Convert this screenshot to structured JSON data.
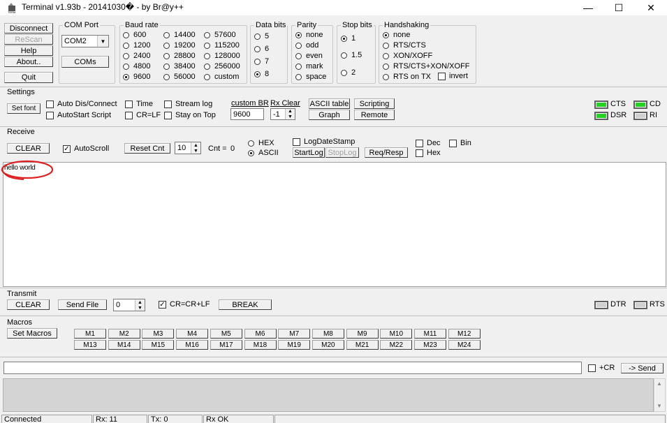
{
  "window": {
    "title": "Terminal v1.93b - 20141030� - by Br@y++",
    "min": "—",
    "max": "☐",
    "close": "✕"
  },
  "left_buttons": {
    "disconnect": "Disconnect",
    "rescan": "ReScan",
    "help": "Help",
    "about": "About..",
    "quit": "Quit"
  },
  "com_port": {
    "title": "COM Port",
    "value": "COM2",
    "coms_button": "COMs"
  },
  "baud_rate": {
    "title": "Baud rate",
    "options": [
      "600",
      "1200",
      "2400",
      "4800",
      "9600",
      "14400",
      "19200",
      "28800",
      "38400",
      "56000",
      "57600",
      "115200",
      "128000",
      "256000",
      "custom"
    ],
    "selected": "9600"
  },
  "data_bits": {
    "title": "Data bits",
    "options": [
      "5",
      "6",
      "7",
      "8"
    ],
    "selected": "8"
  },
  "parity": {
    "title": "Parity",
    "options": [
      "none",
      "odd",
      "even",
      "mark",
      "space"
    ],
    "selected": "none"
  },
  "stop_bits": {
    "title": "Stop bits",
    "options": [
      "1",
      "1.5",
      "2"
    ],
    "selected": "1"
  },
  "handshaking": {
    "title": "Handshaking",
    "options": [
      "none",
      "RTS/CTS",
      "XON/XOFF",
      "RTS/CTS+XON/XOFF",
      "RTS on TX"
    ],
    "invert": "invert",
    "selected": "none"
  },
  "settings": {
    "title": "Settings",
    "set_font": "Set font",
    "auto_dis_connect": "Auto Dis/Connect",
    "autostart_script": "AutoStart Script",
    "time": "Time",
    "cr_lf": "CR=LF",
    "stream_log": "Stream log",
    "stay_on_top": "Stay on Top",
    "custom_br_label": "custom BR",
    "custom_br_value": "9600",
    "rx_clear_label": "Rx Clear",
    "rx_clear_value": "-1",
    "ascii_table": "ASCII table",
    "graph": "Graph",
    "scripting": "Scripting",
    "remote": "Remote"
  },
  "leds": {
    "cts": "CTS",
    "cd": "CD",
    "dsr": "DSR",
    "ri": "RI",
    "dtr": "DTR",
    "rts": "RTS"
  },
  "receive": {
    "title": "Receive",
    "clear": "CLEAR",
    "autoscroll": "AutoScroll",
    "reset_cnt": "Reset Cnt",
    "cnt_spin": "10",
    "cnt_label": "Cnt = ",
    "cnt_value": "0",
    "hex": "HEX",
    "ascii": "ASCII",
    "logdatestamp": "LogDateStamp",
    "startlog": "StartLog",
    "stoplog": "StopLog",
    "req_resp": "Req/Resp",
    "dec": "Dec",
    "hex2": "Hex",
    "bin": "Bin",
    "text": "hello world"
  },
  "transmit": {
    "title": "Transmit",
    "clear": "CLEAR",
    "send_file": "Send File",
    "spin_value": "0",
    "cr_crlf": "CR=CR+LF",
    "break": "BREAK"
  },
  "macros": {
    "title": "Macros",
    "set_macros": "Set Macros",
    "row1": [
      "M1",
      "M2",
      "M3",
      "M4",
      "M5",
      "M6",
      "M7",
      "M8",
      "M9",
      "M10",
      "M11",
      "M12"
    ],
    "row2": [
      "M13",
      "M14",
      "M15",
      "M16",
      "M17",
      "M18",
      "M19",
      "M20",
      "M21",
      "M22",
      "M23",
      "M24"
    ]
  },
  "send": {
    "plus_cr": "+CR",
    "send_button": "-> Send",
    "input_value": ""
  },
  "status": {
    "connected": "Connected",
    "rx": "Rx: 11",
    "tx": "Tx: 0",
    "rxok": "Rx OK"
  },
  "annotation_color": "#e02020"
}
